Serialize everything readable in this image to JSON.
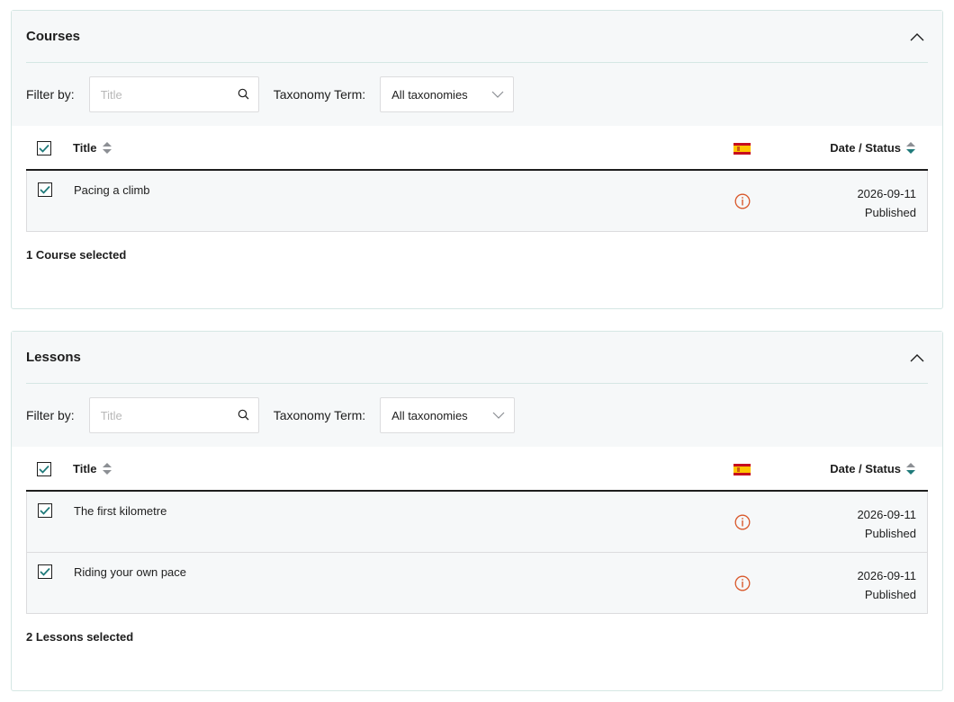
{
  "icons": {
    "collapse": "chevron-up-icon",
    "search": "search-icon",
    "dropdown": "chevron-down-icon",
    "sort": "sort-icon",
    "flag": "spain-flag-icon",
    "warning": "info-warning-icon",
    "checkbox": "checkmark-icon"
  },
  "colors": {
    "accent": "#1f7a7a",
    "warning": "#d9582b",
    "border": "#d5e7e4",
    "panel_bg": "#f6f8f9"
  },
  "courses": {
    "title": "Courses",
    "filter_label": "Filter by:",
    "search_placeholder": "Title",
    "search_value": "",
    "taxonomy_label": "Taxonomy Term:",
    "taxonomy_value": "All taxonomies",
    "col_title": "Title",
    "col_date": "Date / Status",
    "select_all_checked": true,
    "rows": [
      {
        "title": "Pacing a climb",
        "date": "2026-09-11",
        "status": "Published",
        "checked": true
      }
    ],
    "selected_text": "1 Course selected"
  },
  "lessons": {
    "title": "Lessons",
    "filter_label": "Filter by:",
    "search_placeholder": "Title",
    "search_value": "",
    "taxonomy_label": "Taxonomy Term:",
    "taxonomy_value": "All taxonomies",
    "col_title": "Title",
    "col_date": "Date / Status",
    "select_all_checked": true,
    "rows": [
      {
        "title": "The first kilometre",
        "date": "2026-09-11",
        "status": "Published",
        "checked": true
      },
      {
        "title": "Riding your own pace",
        "date": "2026-09-11",
        "status": "Published",
        "checked": true
      }
    ],
    "selected_text": "2 Lessons selected"
  }
}
